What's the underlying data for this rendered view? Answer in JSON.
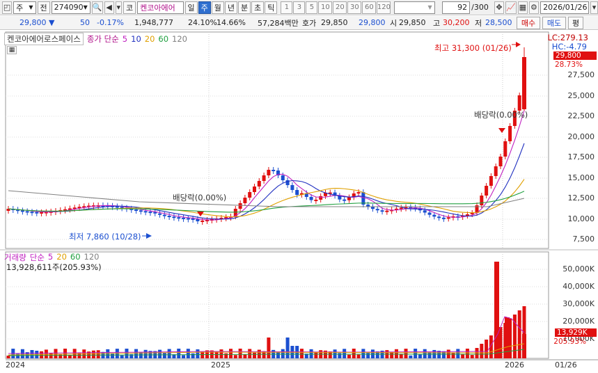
{
  "toolbar": {
    "market": "주",
    "prefix": "전",
    "code": "274090",
    "category": "코",
    "stock_name": "켄코아에어",
    "periods": [
      "일",
      "주",
      "월",
      "년",
      "분",
      "초",
      "틱"
    ],
    "selected_period": "주",
    "intervals": [
      "1",
      "3",
      "5",
      "10",
      "20",
      "30",
      "60",
      "120"
    ],
    "count": "92",
    "count_total": "/300",
    "date": "2026/01/26"
  },
  "quote": {
    "price": "29,800",
    "change": "50",
    "change_pct": "-0.17%",
    "volume": "1,948,777",
    "turnover_pct": "24.10%",
    "vol_ratio": "14.66%",
    "amount": "57,284백만",
    "ask_label": "호가",
    "ask": "29,850",
    "bid": "29,800",
    "open_label": "시",
    "open": "29,850",
    "high_label": "고",
    "high": "30,200",
    "low_label": "저",
    "low": "28,500",
    "buy_label": "매수",
    "sell_label": "매도",
    "eval_label": "평"
  },
  "price_panel": {
    "name": "켄코아에어로스페이스",
    "legend_title": "종가 단순",
    "ma": [
      "5",
      "10",
      "20",
      "60",
      "120"
    ],
    "lc": "LC:279.13",
    "hc": "HC:-4.79",
    "current_tag": "29,800",
    "pct_tag": "28.73%",
    "high_label": "최고 31,300 (01/26)",
    "low_label": "최저 7,860 (10/28)",
    "div_label_1": "배당락(0.00%)",
    "div_label_2": "배당락(0.00%)",
    "ticks": [
      "27,500",
      "25,000",
      "22,500",
      "20,000",
      "17,500",
      "15,000",
      "12,500",
      "10,000",
      "7,500"
    ]
  },
  "volume_panel": {
    "legend_title": "거래량",
    "legend_kind": "단순",
    "ma": [
      "5",
      "20",
      "60",
      "120"
    ],
    "info": "13,928,611주(205.93%)",
    "ticks": [
      "50,000K",
      "40,000K",
      "30,000K",
      "20,000K",
      "10,000K"
    ],
    "current_tag": "13,929K",
    "pct_tag": "205.93%"
  },
  "xaxis": {
    "labels": [
      "2024",
      "2025",
      "2026",
      "01/26"
    ]
  },
  "colors": {
    "up": "#e01010",
    "down": "#1b4fd0",
    "ma5": "#c020c0",
    "ma10": "#2030c0",
    "ma20": "#e0a000",
    "ma60": "#20a040",
    "ma120": "#808080"
  }
}
